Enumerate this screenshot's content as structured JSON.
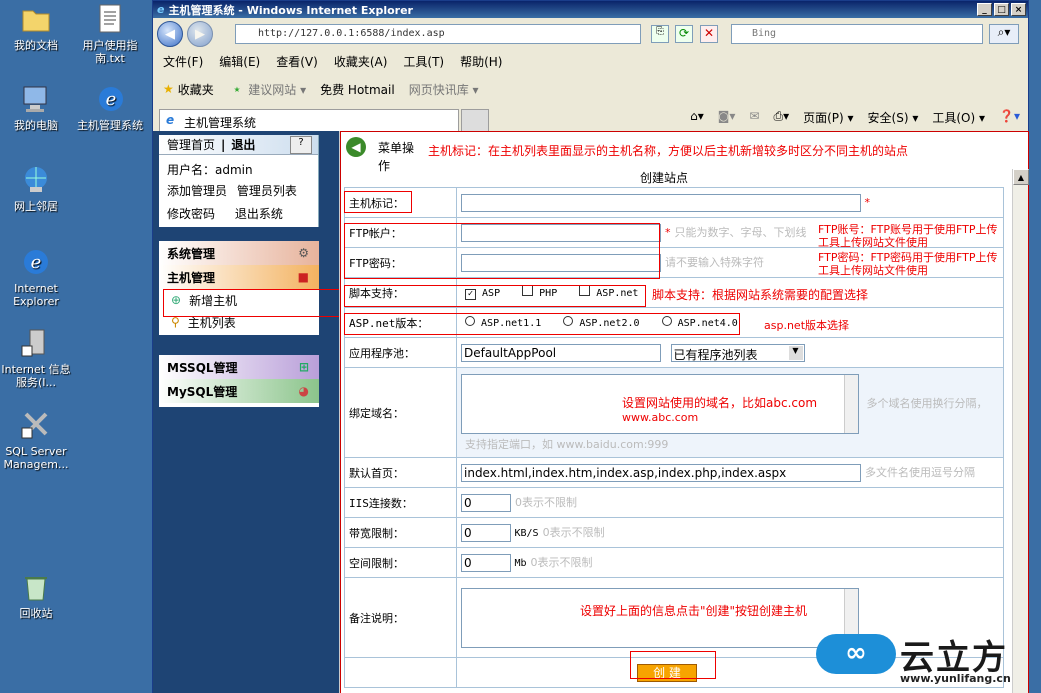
{
  "desktop": {
    "icons": [
      {
        "label": "我的文档"
      },
      {
        "label": "用户使用指南.txt"
      },
      {
        "label": "我的电脑"
      },
      {
        "label": "主机管理系统"
      },
      {
        "label": "网上邻居"
      },
      {
        "label": "Internet Explorer"
      },
      {
        "label": "Internet 信息服务(I..."
      },
      {
        "label": "SQL Server Managem..."
      },
      {
        "label": "回收站"
      }
    ]
  },
  "window": {
    "title": "主机管理系统 - Windows Internet Explorer",
    "address": "http://127.0.0.1:6588/index.asp",
    "search_placeholder": "Bing",
    "menu": [
      "文件(F)",
      "编辑(E)",
      "查看(V)",
      "收藏夹(A)",
      "工具(T)",
      "帮助(H)"
    ],
    "favbar": {
      "favorites": "收藏夹",
      "suggested": "建议网站 ▾",
      "hotmail": "免费 Hotmail",
      "webslices": "网页快讯库 ▾"
    },
    "tab_title": "主机管理系统",
    "cmdbar": {
      "page": "页面(P) ▾",
      "safety": "安全(S) ▾",
      "tools": "工具(O) ▾"
    }
  },
  "sidebar": {
    "top_links": {
      "home": "管理首页",
      "logout": "退出"
    },
    "username_label": "用户名：admin",
    "links": [
      "添加管理员",
      "管理员列表",
      "修改密码",
      "退出系统"
    ],
    "sections": {
      "system": "系统管理",
      "host": "主机管理",
      "mssql": "MSSQL管理",
      "mysql": "MySQL管理"
    },
    "host_items": [
      "新增主机",
      "主机列表"
    ]
  },
  "main": {
    "menu_op": "菜单操作",
    "form_title": "创建站点",
    "rows": {
      "host_tag": {
        "label": "主机标记：",
        "value": ""
      },
      "ftp_user": {
        "label": "FTP帐户：",
        "hint": "只能为数字、字母、下划线"
      },
      "ftp_pass": {
        "label": "FTP密码：",
        "hint": "请不要输入特殊字符"
      },
      "script": {
        "label": "脚本支持：",
        "opts": [
          "ASP",
          "PHP",
          "ASP.net"
        ]
      },
      "aspnet": {
        "label": "ASP.net版本：",
        "opts": [
          "ASP.net1.1",
          "ASP.net2.0",
          "ASP.net4.0"
        ]
      },
      "apppool": {
        "label": "应用程序池：",
        "value": "DefaultAppPool",
        "select": "已有程序池列表"
      },
      "domain": {
        "label": "绑定域名：",
        "hint": "多个域名使用换行分隔，",
        "hint2": "支持指定端口，如 www.baidu.com:999"
      },
      "index": {
        "label": "默认首页：",
        "value": "index.html,index.htm,index.asp,index.php,index.aspx",
        "hint": "多文件名使用逗号分隔"
      },
      "iis": {
        "label": "IIS连接数：",
        "value": "0",
        "hint": "0表示不限制"
      },
      "bandwidth": {
        "label": "带宽限制：",
        "value": "0",
        "unit": "KB/S",
        "hint": "0表示不限制"
      },
      "space": {
        "label": "空间限制：",
        "value": "0",
        "unit": "Mb",
        "hint": "0表示不限制"
      },
      "note": {
        "label": "备注说明："
      }
    },
    "submit": "创 建"
  },
  "annotations": {
    "host_tag": "主机标记：在主机列表里面显示的主机名称，方便以后主机新增较多时区分不同主机的站点",
    "ftp_user": "FTP账号：FTP账号用于使用FTP上传工具上传网站文件使用",
    "ftp_pass": "FTP密码：FTP密码用于使用FTP上传工具上传网站文件使用",
    "script": "脚本支持：根据网站系统需要的配置选择",
    "aspnet": "asp.net版本选择",
    "domain": "设置网站使用的域名，比如abc.com",
    "domain2": "www.abc.com",
    "create": "设置好上面的信息点击\"创建\"按钮创建主机",
    "star": "*"
  },
  "watermark": {
    "brand": "云立方",
    "url": "www.yunlifang.cn"
  }
}
